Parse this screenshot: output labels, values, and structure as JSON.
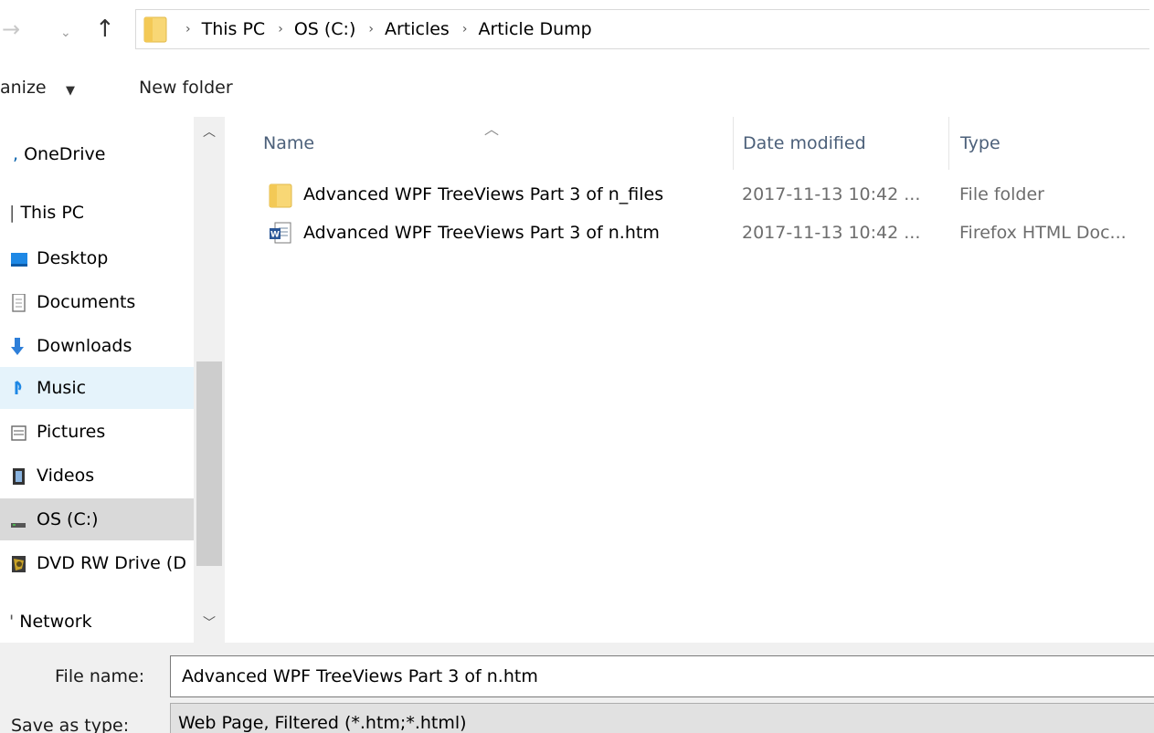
{
  "address_bar": {
    "back_glyph": "→",
    "recent_glyph": "⌄",
    "up_glyph": "↑",
    "breadcrumbs": [
      "This PC",
      "OS (C:)",
      "Articles",
      "Article Dump"
    ]
  },
  "toolbar": {
    "organize_label": "anize",
    "new_folder_label": "New folder"
  },
  "nav_pane": {
    "items": [
      {
        "label": "OneDrive",
        "icon": "onedrive-icon"
      },
      {
        "label": "This PC",
        "icon": "this-pc-icon"
      },
      {
        "label": "Desktop",
        "icon": "desktop-icon"
      },
      {
        "label": "Documents",
        "icon": "documents-icon"
      },
      {
        "label": "Downloads",
        "icon": "downloads-icon"
      },
      {
        "label": "Music",
        "icon": "music-icon"
      },
      {
        "label": "Pictures",
        "icon": "pictures-icon"
      },
      {
        "label": "Videos",
        "icon": "videos-icon"
      },
      {
        "label": "OS (C:)",
        "icon": "drive-icon"
      },
      {
        "label": "DVD RW Drive (D",
        "icon": "dvd-drive-icon"
      },
      {
        "label": "Network",
        "icon": "network-icon"
      }
    ],
    "hovered": "Music",
    "selected": "OS (C:)"
  },
  "file_list": {
    "columns": {
      "name": "Name",
      "date": "Date modified",
      "type": "Type"
    },
    "rows": [
      {
        "name": "Advanced WPF TreeViews Part 3 of n_files",
        "date": "2017-11-13 10:42 ...",
        "type": "File folder",
        "icon": "folder-icon"
      },
      {
        "name": "Advanced WPF TreeViews Part 3 of n.htm",
        "date": "2017-11-13 10:42 ...",
        "type": "Firefox HTML Doc...",
        "icon": "word-html-document-icon"
      }
    ]
  },
  "save_fields": {
    "file_name_label": "File name:",
    "file_name_value": "Advanced WPF TreeViews Part 3 of n.htm",
    "save_type_label": "Save as type:",
    "save_type_value": "Web Page, Filtered (*.htm;*.html)"
  },
  "colors": {
    "folder_yellow": "#f8d775",
    "header_text": "#4c607a",
    "hover_bg": "#e5f3fb",
    "selected_bg": "#d9d9d9"
  }
}
